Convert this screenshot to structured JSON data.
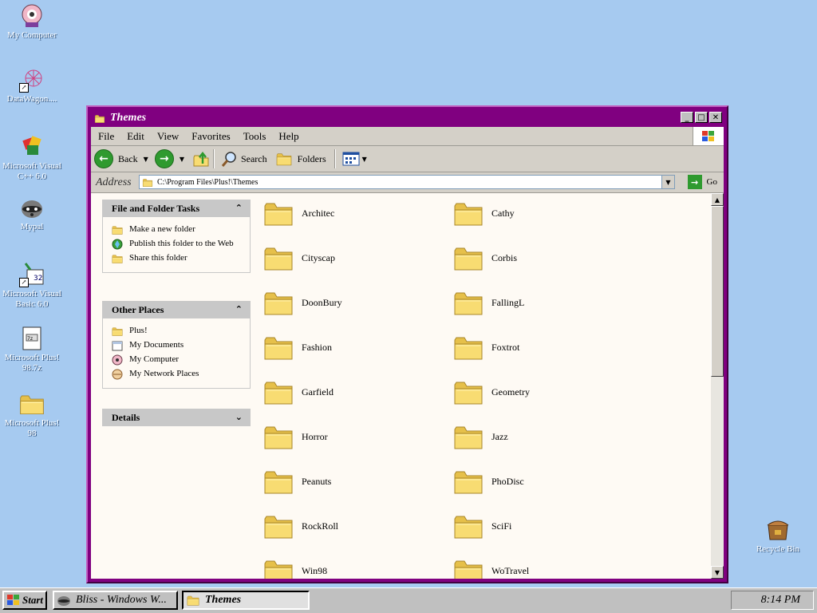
{
  "desktop": {
    "icons": [
      {
        "label": "My Computer",
        "icon": "my-computer-icon"
      },
      {
        "label": "DataWagon....",
        "icon": "datawagon-icon"
      },
      {
        "label": "Microsoft Visual C++ 6.0",
        "icon": "visual-cpp-icon"
      },
      {
        "label": "Mypal",
        "icon": "mypal-icon"
      },
      {
        "label": "Microsoft Visual Basic 6.0",
        "icon": "visual-basic-icon"
      },
      {
        "label": "Microsoft Plus! 98.7z",
        "icon": "archive-icon"
      },
      {
        "label": "Microsoft Plus! 98",
        "icon": "folder-icon"
      },
      {
        "label": "Recycle Bin",
        "icon": "recycle-bin-icon"
      }
    ]
  },
  "window": {
    "title": "Themes",
    "menu": [
      "File",
      "Edit",
      "View",
      "Favorites",
      "Tools",
      "Help"
    ],
    "toolbar": {
      "back": "Back",
      "search": "Search",
      "folders": "Folders"
    },
    "address": {
      "label": "Address",
      "value": "C:\\Program Files\\Plus!\\Themes",
      "go": "Go"
    },
    "panes": {
      "tasks": {
        "title": "File and Folder Tasks",
        "items": [
          "Make a new folder",
          "Publish this folder to the Web",
          "Share this folder"
        ]
      },
      "places": {
        "title": "Other Places",
        "items": [
          "Plus!",
          "My Documents",
          "My Computer",
          "My Network Places"
        ]
      },
      "details": {
        "title": "Details"
      }
    },
    "folders": [
      "Architec",
      "Cathy",
      "Cityscap",
      "Corbis",
      "DoonBury",
      "FallingL",
      "Fashion",
      "Foxtrot",
      "Garfield",
      "Geometry",
      "Horror",
      "Jazz",
      "Peanuts",
      "PhoDisc",
      "RockRoll",
      "SciFi",
      "Win98",
      "WoTravel"
    ]
  },
  "taskbar": {
    "start": "Start",
    "tasks": [
      "Bliss - Windows W...",
      "Themes"
    ],
    "clock": "8:14 PM"
  },
  "colors": {
    "desktop": "#a6caf0",
    "title_bar": "#800080",
    "folder": "#f5d66a"
  }
}
